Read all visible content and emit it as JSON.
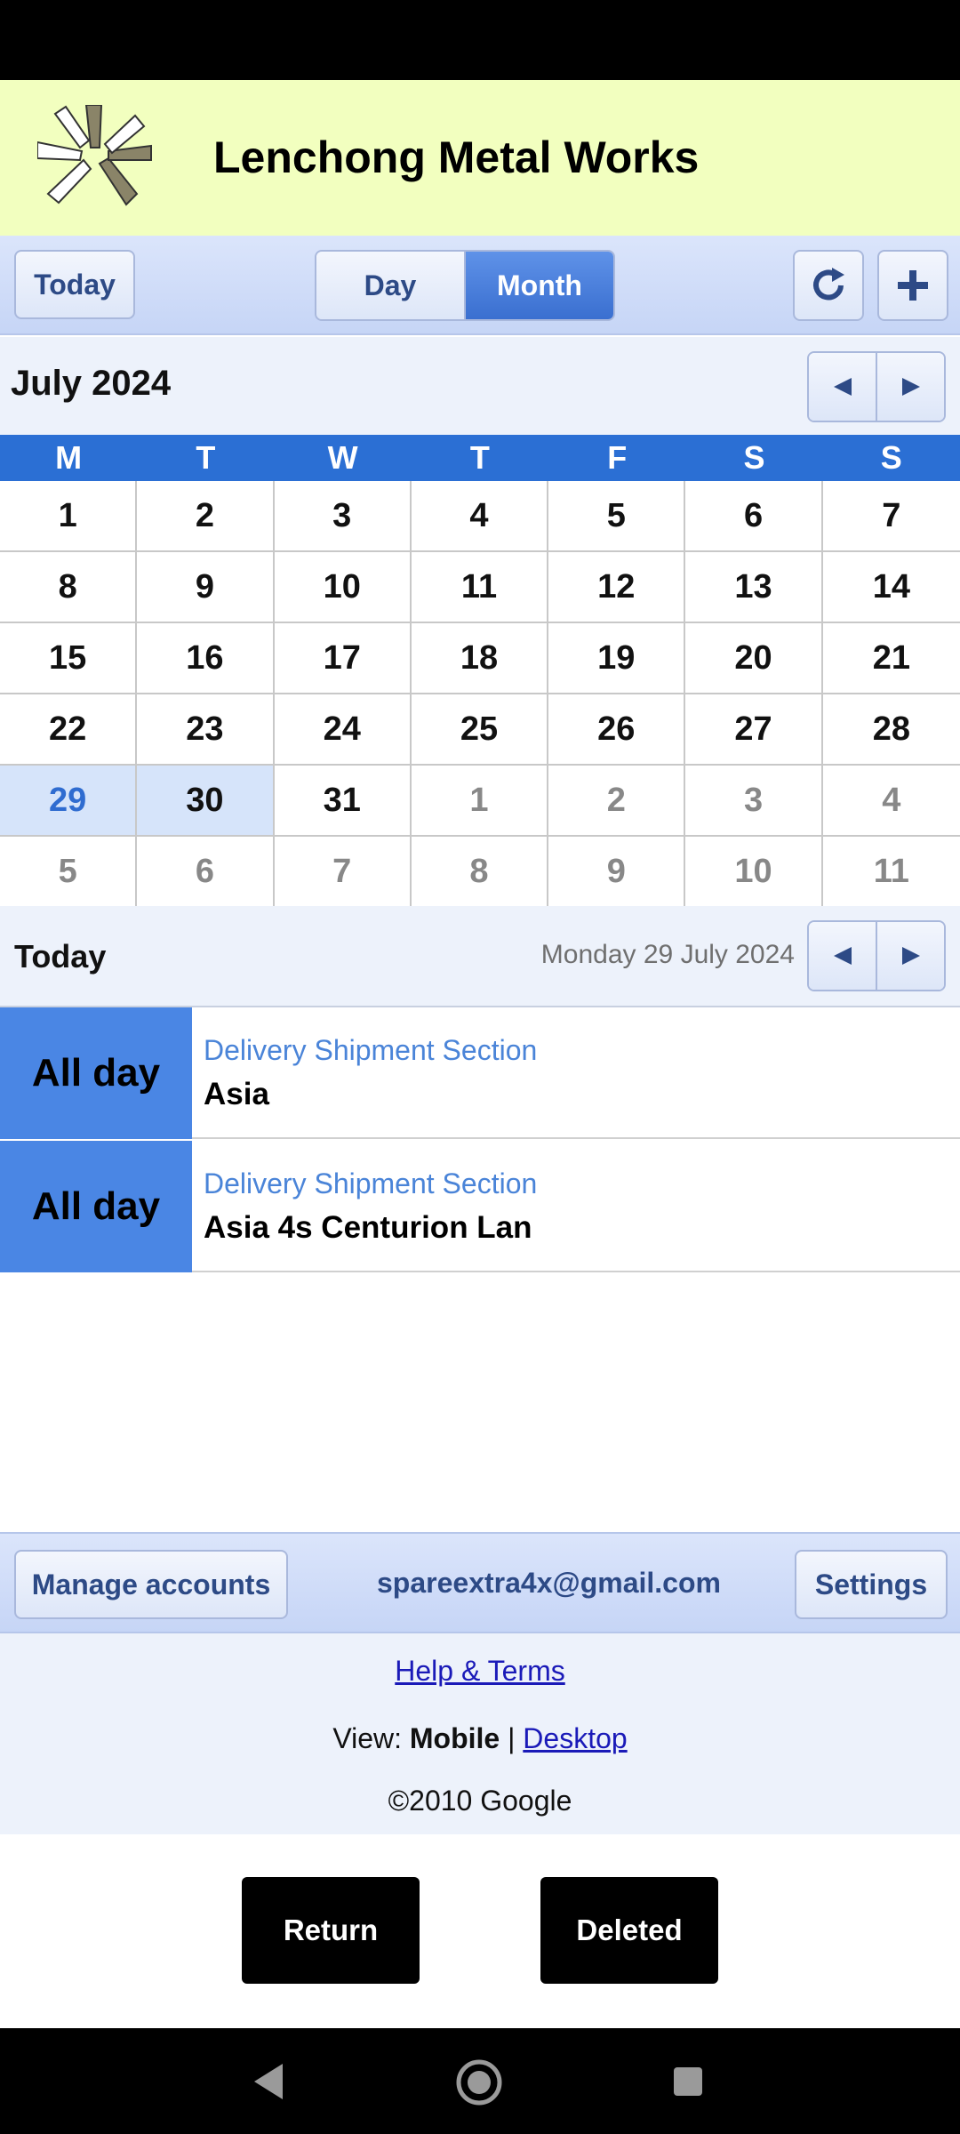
{
  "app": {
    "title": "Lenchong Metal Works"
  },
  "toolbar": {
    "today_label": "Today",
    "day_label": "Day",
    "month_label": "Month"
  },
  "calendar": {
    "month_title": "July 2024",
    "weekdays": [
      "M",
      "T",
      "W",
      "T",
      "F",
      "S",
      "S"
    ],
    "days": [
      [
        "1",
        "2",
        "3",
        "4",
        "5",
        "6",
        "7"
      ],
      [
        "8",
        "9",
        "10",
        "11",
        "12",
        "13",
        "14"
      ],
      [
        "15",
        "16",
        "17",
        "18",
        "19",
        "20",
        "21"
      ],
      [
        "22",
        "23",
        "24",
        "25",
        "26",
        "27",
        "28"
      ],
      [
        "29",
        "30",
        "31",
        "1",
        "2",
        "3",
        "4"
      ],
      [
        "5",
        "6",
        "7",
        "8",
        "9",
        "10",
        "11"
      ]
    ],
    "today_color": "#2f6cd0",
    "selected_bg": "#d6e4fa"
  },
  "agenda": {
    "label": "Today",
    "date": "Monday 29 July 2024",
    "events": [
      {
        "time": "All day",
        "calendar": "Delivery Shipment Section",
        "title": "Asia"
      },
      {
        "time": "All day",
        "calendar": "Delivery Shipment Section",
        "title": "Asia 4s Centurion Lan"
      }
    ]
  },
  "account": {
    "manage_label": "Manage accounts",
    "email": "spareextra4x@gmail.com",
    "settings_label": "Settings"
  },
  "footer": {
    "help_label": "Help & Terms",
    "view_prefix": "View: ",
    "view_mobile": "Mobile",
    "view_sep": " | ",
    "view_desktop": "Desktop",
    "copyright": "©2010 Google"
  },
  "actions": {
    "return_label": "Return",
    "deleted_label": "Deleted"
  },
  "icons": {
    "logo": "star-logo-icon",
    "refresh": "refresh-icon",
    "add": "plus-icon",
    "prev": "arrow-left-icon",
    "next": "arrow-right-icon",
    "back": "back-icon",
    "home": "home-icon",
    "recents": "recents-icon"
  },
  "colors": {
    "accent": "#2b6fd4",
    "header_bg": "#f2ffbf",
    "event_block": "#4a86e4"
  }
}
